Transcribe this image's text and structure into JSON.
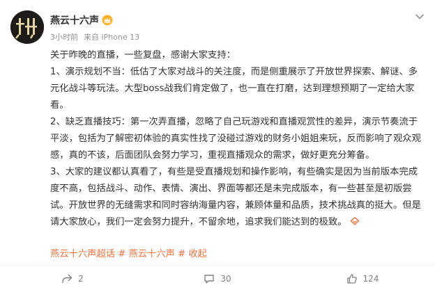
{
  "post": {
    "author": "燕云十六声",
    "time": "3小时前",
    "source": "来自 iPhone 13",
    "avatar_label": "十廾",
    "intro": "关于昨晚的直播，一些复盘，感谢大家支持：",
    "paragraphs": [
      "1、演示规划不当：低估了大家对战斗的关注度，而是侧重展示了开放世界探索、解谜、多元化战斗等玩法。大型boss战我们肯定做了，也一直在打磨，达到理想预期了一定给大家看。",
      "2、缺乏直播技巧：第一次弄直播，忽略了自己玩游戏和直播观赏性的差异，演示节奏流于平淡，包括为了解密初体验的真实性找了没碰过游戏的财务小姐姐来玩，反而影响了观众观感，真的不该，后面团队会努力学习，重视直播观众的需求，做好更充分筹备。",
      "3、大家的建议都认真看了，有些是受直播规划和操作影响，有些确实是因为当前版本完成度不高，包括战斗、动作、表情、演出、界面等都还是未完成版本，有一些甚至是初版尝试。开放世界的无缝需求和同时容纳海量内容，兼顾体量和品质，技术挑战真的挺大。但是请大家放心，我们一定会努力提升，不留余地，追求我们能达到的极致。"
    ],
    "tags": [
      "燕云十六声超话",
      "# 燕云十六声 #",
      "收起"
    ]
  },
  "actions": {
    "repost_count": "2",
    "comment_count": "30",
    "like_count": "124"
  },
  "colors": {
    "accent": "#eb7340",
    "text": "#333333",
    "muted": "#939393"
  },
  "icons": [
    "vip-crown-icon",
    "chevron-down-icon",
    "topic-tail-icon",
    "share-icon",
    "comment-icon",
    "like-icon"
  ]
}
